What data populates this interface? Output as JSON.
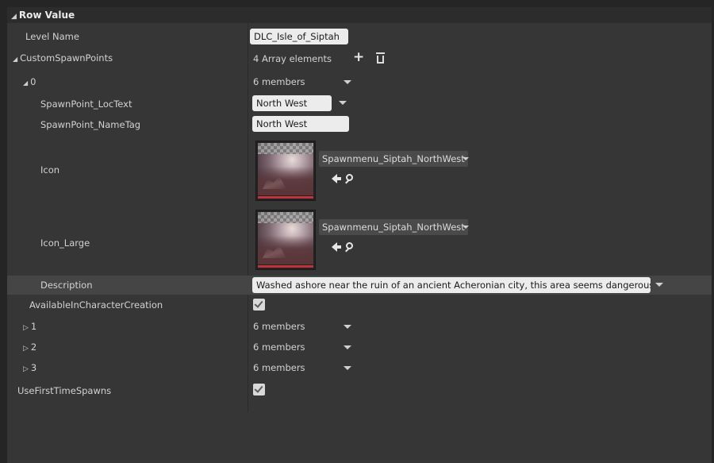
{
  "header": {
    "title": "Row Value"
  },
  "rows": {
    "level_name": {
      "label": "Level Name",
      "value": "DLC_Isle_of_Siptah"
    },
    "custom_spawn_points": {
      "label": "CustomSpawnPoints",
      "value": "4 Array elements"
    },
    "element0": {
      "label": "0",
      "value": "6 members"
    },
    "loc_text": {
      "label": "SpawnPoint_LocText",
      "value": "North West"
    },
    "name_tag": {
      "label": "SpawnPoint_NameTag",
      "value": "North West"
    },
    "icon": {
      "label": "Icon",
      "asset": "Spawnmenu_Siptah_NorthWest"
    },
    "icon_large": {
      "label": "Icon_Large",
      "asset": "Spawnmenu_Siptah_NorthWest"
    },
    "description": {
      "label": "Description",
      "value": "Washed ashore near the ruin of an ancient Acheronian city, this area seems dangerous..."
    },
    "available": {
      "label": "AvailableInCharacterCreation",
      "checked": true
    },
    "element1": {
      "label": "1",
      "value": "6 members"
    },
    "element2": {
      "label": "2",
      "value": "6 members"
    },
    "element3": {
      "label": "3",
      "value": "6 members"
    },
    "use_first": {
      "label": "UseFirstTimeSpawns",
      "checked": true
    }
  },
  "icons": {
    "collapse": "triangle-down-icon",
    "expand": "triangle-right-icon",
    "add": "plus-icon",
    "delete": "trash-icon",
    "browse": "arrow-left-icon",
    "find": "search-icon",
    "dropdown": "chevron-down-icon",
    "check": "check-icon"
  },
  "colors": {
    "panel": "#363636",
    "header": "#2c2c2c",
    "highlight_row": "#454545",
    "textbox": "#ececec",
    "thumbnail_bar": "#c0333b"
  }
}
